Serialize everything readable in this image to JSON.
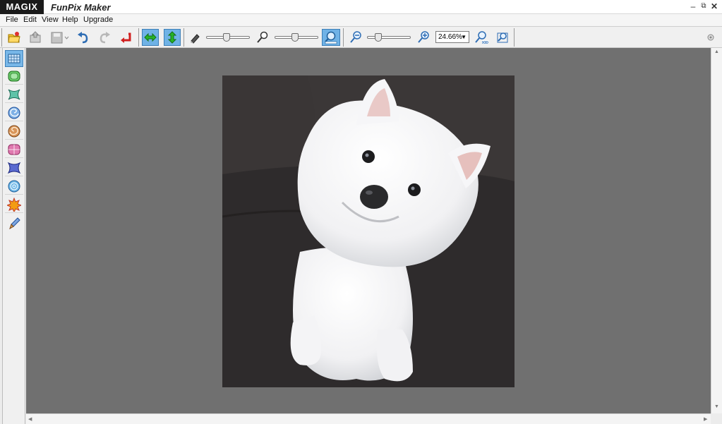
{
  "titlebar": {
    "brand": "MAGIX",
    "app_title": "FunPix Maker",
    "minimize": "–",
    "restore": "⧉",
    "close": "✕"
  },
  "menu": [
    "File",
    "Edit",
    "View",
    "Help",
    "Upgrade"
  ],
  "toolbar": {
    "zoom_value": "24.66%",
    "zoom_options": [
      "24.66%"
    ],
    "icons": [
      "open-icon",
      "export-icon",
      "save-icon",
      "undo-icon",
      "redo-icon",
      "reset-icon",
      "fit-width-icon",
      "fit-height-icon",
      "eraser-icon",
      "brush-size-icon",
      "effect-zoom-icon",
      "zoom-out-icon",
      "zoom-in-icon",
      "zoom-100-icon",
      "zoom-fit-icon"
    ],
    "sliders": {
      "brush_size": 0.45,
      "effect_strength": 0.45,
      "zoom": 0.2
    }
  },
  "left_tools": [
    "distortion-grid-icon",
    "bulge-icon",
    "pinch-icon",
    "swirl-icon",
    "twirl-icon",
    "barrel-icon",
    "pinch-square-icon",
    "ripple-icon",
    "explode-icon",
    "brush-icon"
  ],
  "colors": {
    "accent": "#6fb2e6",
    "canvas": "#707070",
    "brand_bg": "#1a1a1a"
  }
}
